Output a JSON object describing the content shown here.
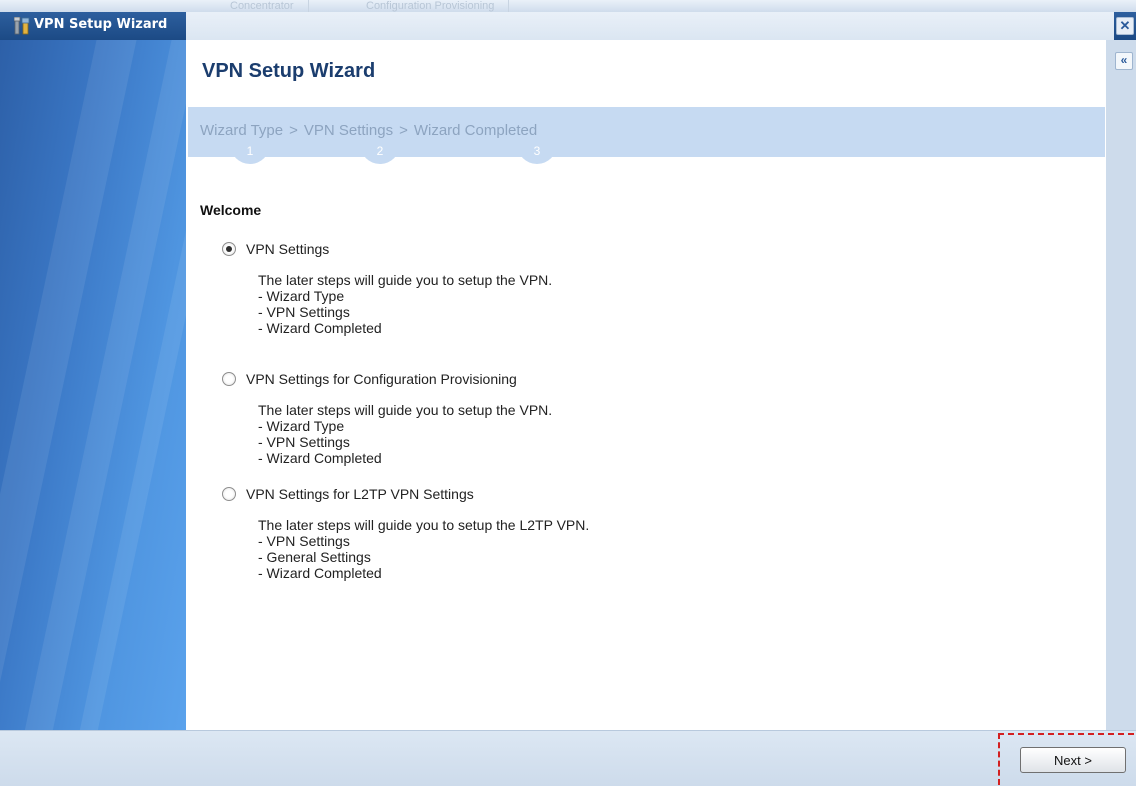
{
  "background_tabs": [
    "Concentrator",
    "Configuration Provisioning"
  ],
  "window": {
    "title": "VPN Setup Wizard",
    "close_symbol": "✕",
    "collapse_symbol": "«"
  },
  "page": {
    "title": "VPN Setup Wizard"
  },
  "steps": [
    {
      "label": "Wizard Type",
      "number": "1"
    },
    {
      "label": "VPN Settings",
      "number": "2"
    },
    {
      "label": "Wizard Completed",
      "number": "3"
    }
  ],
  "step_separator": ">",
  "welcome_heading": "Welcome",
  "options": [
    {
      "label": "VPN Settings",
      "checked": true,
      "description": [
        "The later steps will guide you to setup the VPN.",
        "- Wizard Type",
        "- VPN Settings",
        "- Wizard Completed"
      ]
    },
    {
      "label": "VPN Settings for Configuration Provisioning",
      "checked": false,
      "description": [
        "The later steps will guide you to setup the VPN.",
        "- Wizard Type",
        "- VPN Settings",
        "- Wizard Completed"
      ]
    },
    {
      "label": "VPN Settings for L2TP VPN Settings",
      "checked": false,
      "description": [
        "The later steps will guide you to setup the L2TP VPN.",
        "- VPN Settings",
        "- General Settings",
        "- Wizard Completed"
      ]
    }
  ],
  "footer": {
    "next_label": "Next >"
  },
  "colors": {
    "title_bar": "#1c4a85",
    "steps_bar": "#c6daf2",
    "highlight_dash": "#d32020"
  }
}
